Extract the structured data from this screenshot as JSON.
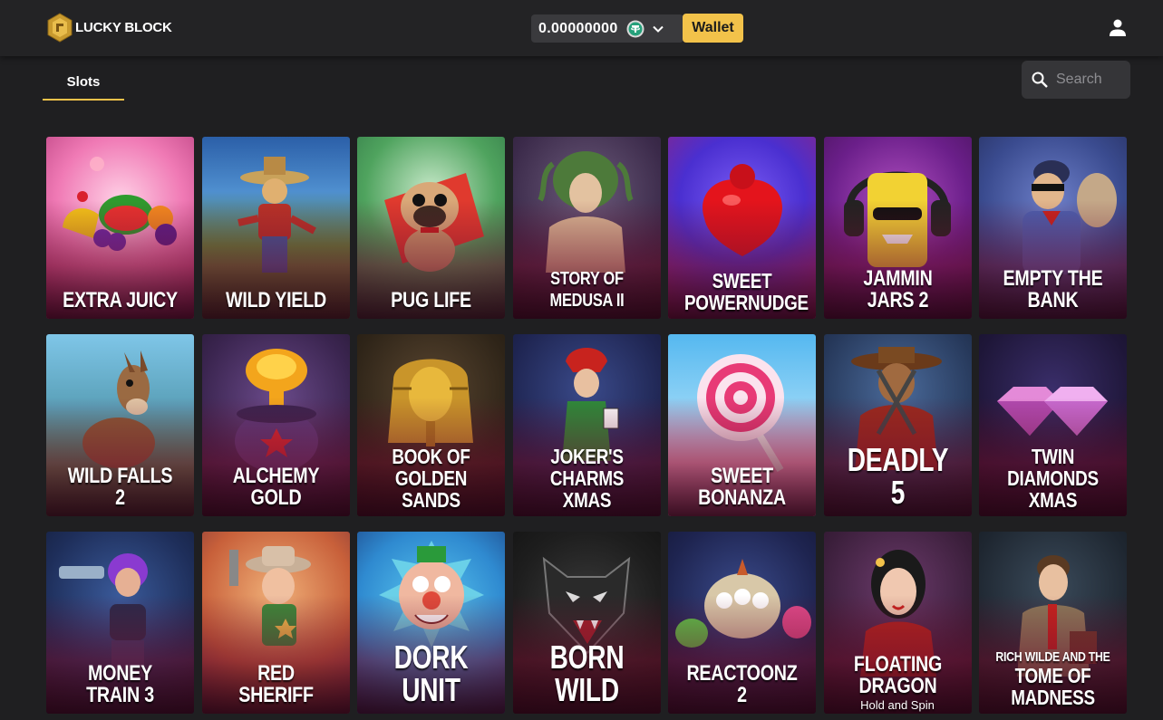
{
  "brand": {
    "name": "LUCKY BLOCK"
  },
  "wallet": {
    "balance": "0.00000000",
    "currency_icon": "tether-coin-icon",
    "button_label": "Wallet"
  },
  "header": {
    "account_icon": "user-icon"
  },
  "tabs": [
    {
      "label": "Slots",
      "active": true
    }
  ],
  "search": {
    "placeholder": "Search"
  },
  "colors": {
    "accent": "#f2c24a",
    "background": "#1f1f21",
    "topbar": "#232325"
  },
  "games": [
    {
      "title": "EXTRA JUICY"
    },
    {
      "title": "WILD YIELD"
    },
    {
      "title": "PUG LIFE"
    },
    {
      "title": "STORY OF MEDUSA II"
    },
    {
      "title_line1": "SWEET",
      "title_line2": "POWERNUDGE"
    },
    {
      "title": "JAMMIN JARS 2"
    },
    {
      "title": "EMPTY THE BANK"
    },
    {
      "title": "WILD FALLS 2"
    },
    {
      "title": "ALCHEMY GOLD"
    },
    {
      "title_line1": "BOOK OF",
      "title_line2": "GOLDEN SANDS"
    },
    {
      "title_line1": "JOKER'S CHARMS",
      "title_line2": "XMAS"
    },
    {
      "title": "SWEET BONANZA"
    },
    {
      "title": "DEADLY 5"
    },
    {
      "title_line1": "TWIN DIAMONDS",
      "title_line2": "XMAS"
    },
    {
      "title": "MONEY TRAIN 3"
    },
    {
      "title": "RED SHERIFF"
    },
    {
      "title": "DORK UNIT"
    },
    {
      "title": "BORN WILD"
    },
    {
      "title": "REACTOONZ 2"
    },
    {
      "title": "FLOATING DRAGON",
      "subtitle": "Hold and Spin"
    },
    {
      "title_line1": "RICH WILDE AND THE",
      "title_line2": "TOME OF MADNESS"
    }
  ]
}
